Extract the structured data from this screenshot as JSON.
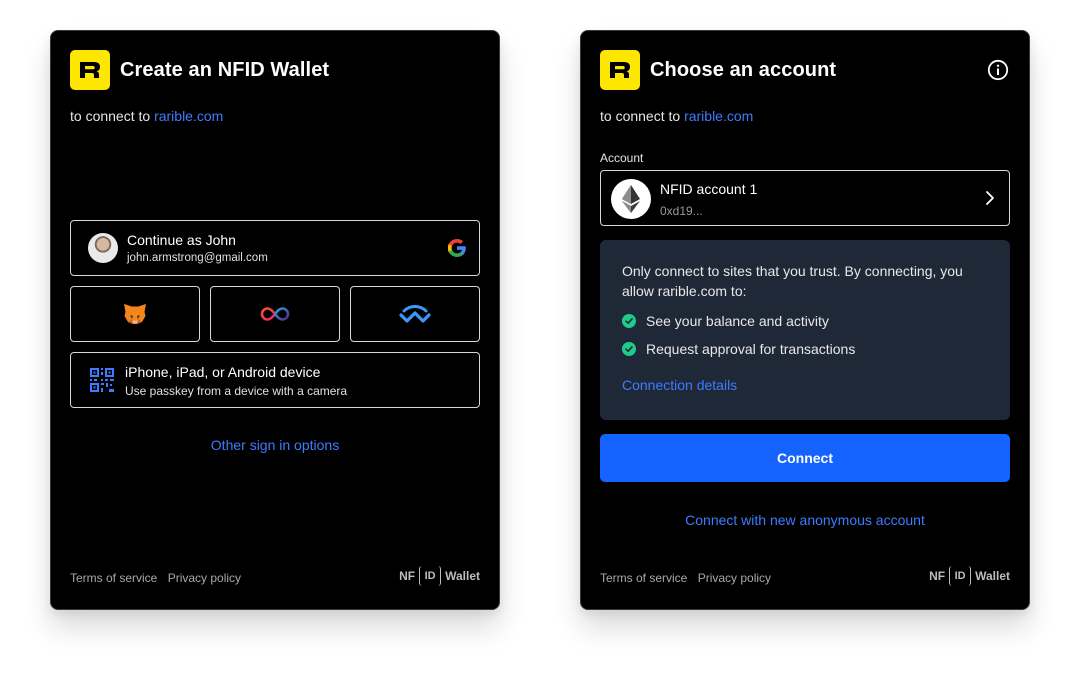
{
  "create_card": {
    "title": "Create an NFID Wallet",
    "subtitle_prefix": "to connect to",
    "subtitle_link": "rarible.com",
    "google": {
      "name": "Continue as John",
      "email": "john.armstrong@gmail.com"
    },
    "wallet_icons": [
      "metamask-icon",
      "internet-identity-icon",
      "walletconnect-icon"
    ],
    "device": {
      "title": "iPhone, iPad, or Android device",
      "subtitle": "Use passkey from a device with a camera"
    },
    "other_options": "Other sign in options",
    "footer": {
      "terms": "Terms of service",
      "privacy": "Privacy policy",
      "brand_nf": "NF",
      "brand_id": "ID",
      "brand_wallet": "Wallet"
    }
  },
  "choose_card": {
    "title": "Choose an account",
    "subtitle_prefix": "to connect to",
    "subtitle_link": "rarible.com",
    "account_label": "Account",
    "account": {
      "name": "NFID account 1",
      "address": "0xd19..."
    },
    "trust_text": "Only connect to sites that you trust. By connecting, you allow rarible.com to:",
    "permissions": [
      "See your balance and activity",
      "Request approval for transactions"
    ],
    "connection_details": "Connection details",
    "connect_button": "Connect",
    "anon_link": "Connect with new anonymous account",
    "footer": {
      "terms": "Terms of service",
      "privacy": "Privacy policy",
      "brand_nf": "NF",
      "brand_id": "ID",
      "brand_wallet": "Wallet"
    }
  },
  "colors": {
    "brand_yellow": "#fde600",
    "link_blue": "#3d7bff",
    "connect_blue": "#1463ff",
    "check_green": "#1fcb8a",
    "trust_bg": "#1f2837"
  }
}
